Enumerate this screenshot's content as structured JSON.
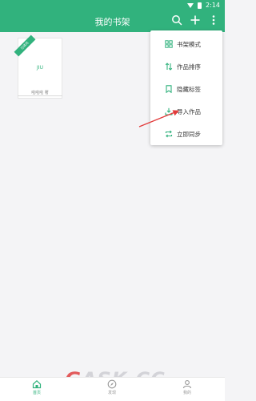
{
  "status_bar": {
    "time": "2:14"
  },
  "header": {
    "title": "我的书架",
    "accent": "#31b27d"
  },
  "book": {
    "ribbon": "已读完",
    "title": "JIU",
    "author": "啦啦啦 著"
  },
  "menu": {
    "items": [
      {
        "label": "书架模式",
        "icon": "grid-icon"
      },
      {
        "label": "作品排序",
        "icon": "sort-icon"
      },
      {
        "label": "隐藏标签",
        "icon": "bookmark-icon"
      },
      {
        "label": "导入作品",
        "icon": "import-icon"
      },
      {
        "label": "立即同步",
        "icon": "sync-icon"
      }
    ]
  },
  "bottom_nav": {
    "tabs": [
      {
        "label": "首页",
        "icon": "home-icon",
        "active": true
      },
      {
        "label": "发现",
        "icon": "compass-icon",
        "active": false
      },
      {
        "label": "我的",
        "icon": "user-icon",
        "active": false
      }
    ]
  },
  "watermark": {
    "part1": "G",
    "part2": "ASK.CC"
  }
}
